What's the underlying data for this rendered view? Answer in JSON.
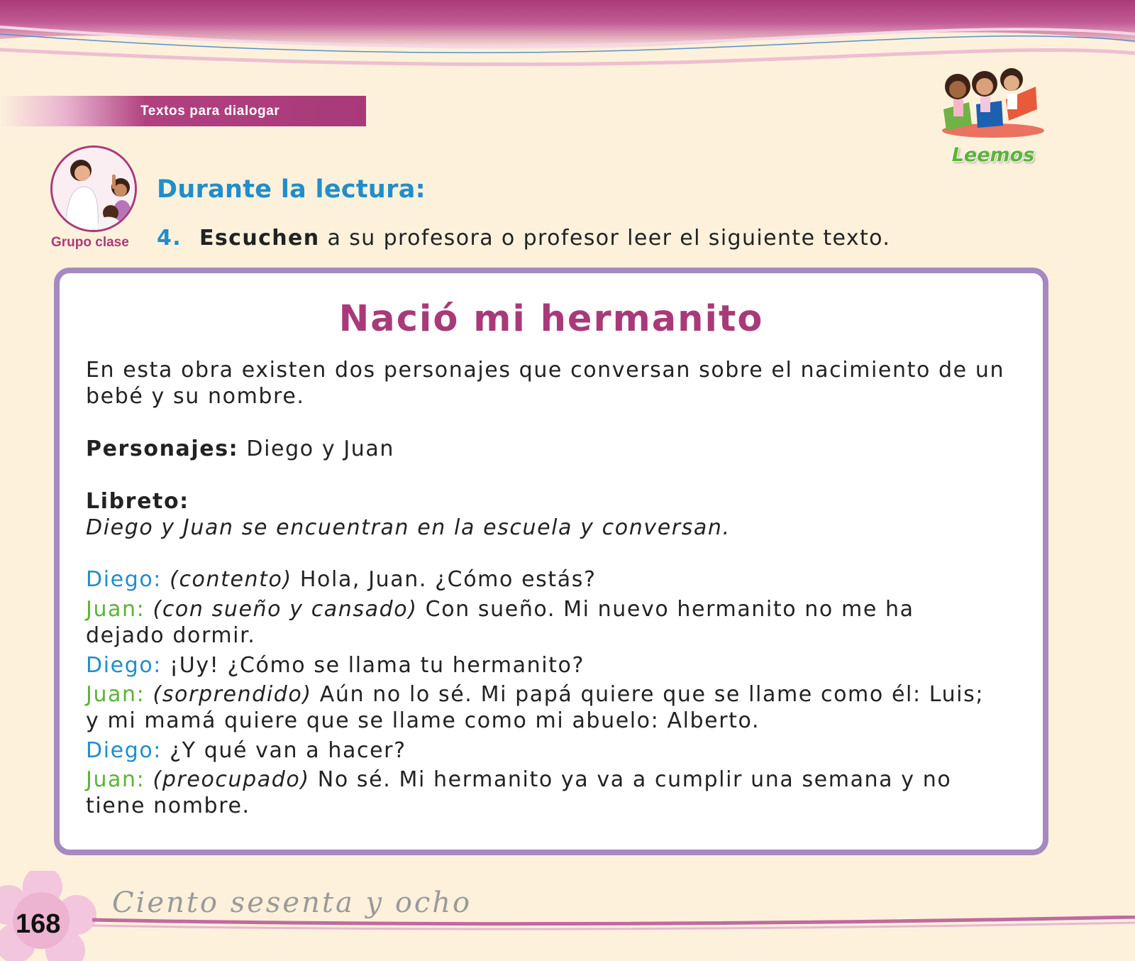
{
  "header": {
    "section_label": "Textos para dialogar",
    "badge_label": "Leemos"
  },
  "activity": {
    "group_label": "Grupo clase",
    "phase_title": "Durante la lectura:",
    "number": "4.",
    "verb": "Escuchen",
    "rest": " a su profesora o profesor leer el siguiente texto."
  },
  "reading": {
    "title": "Nació mi hermanito",
    "intro_line1": "En esta obra existen dos personajes que conversan sobre el nacimiento de un",
    "intro_line2": "bebé y su nombre.",
    "characters_label": "Personajes:",
    "characters_value": " Diego y Juan",
    "script_label": "Libreto:",
    "stage_direction": "Diego y Juan se encuentran en la escuela y conversan.",
    "dialogue": [
      {
        "speaker": "Diego:",
        "direction": "(contento)",
        "line1": " Hola, Juan. ¿Cómo estás?",
        "line2": ""
      },
      {
        "speaker": "Juan:",
        "direction": "(con sueño y cansado)",
        "line1": " Con sueño. Mi nuevo hermanito no me ha",
        "line2": "dejado dormir."
      },
      {
        "speaker": "Diego:",
        "direction": "",
        "line1": "¡Uy! ¿Cómo se llama tu hermanito?",
        "line2": ""
      },
      {
        "speaker": "Juan:",
        "direction": "(sorprendido)",
        "line1": " Aún no lo sé. Mi papá quiere que se llame como él: Luis;",
        "line2": "y mi mamá quiere que se llame como mi abuelo: Alberto."
      },
      {
        "speaker": "Diego:",
        "direction": "",
        "line1": "¿Y qué van a hacer?",
        "line2": ""
      },
      {
        "speaker": "Juan:",
        "direction": "(preocupado)",
        "line1": " No sé. Mi hermanito ya va a cumplir una semana y no",
        "line2": "tiene nombre."
      }
    ]
  },
  "footer": {
    "page_number": "168",
    "page_words": "Ciento sesenta y ocho"
  },
  "colors": {
    "magenta": "#a93a79",
    "blue": "#1f8ecb",
    "green": "#5cb338",
    "box_border": "#a589c0",
    "page_bg": "#fdf1dc"
  }
}
